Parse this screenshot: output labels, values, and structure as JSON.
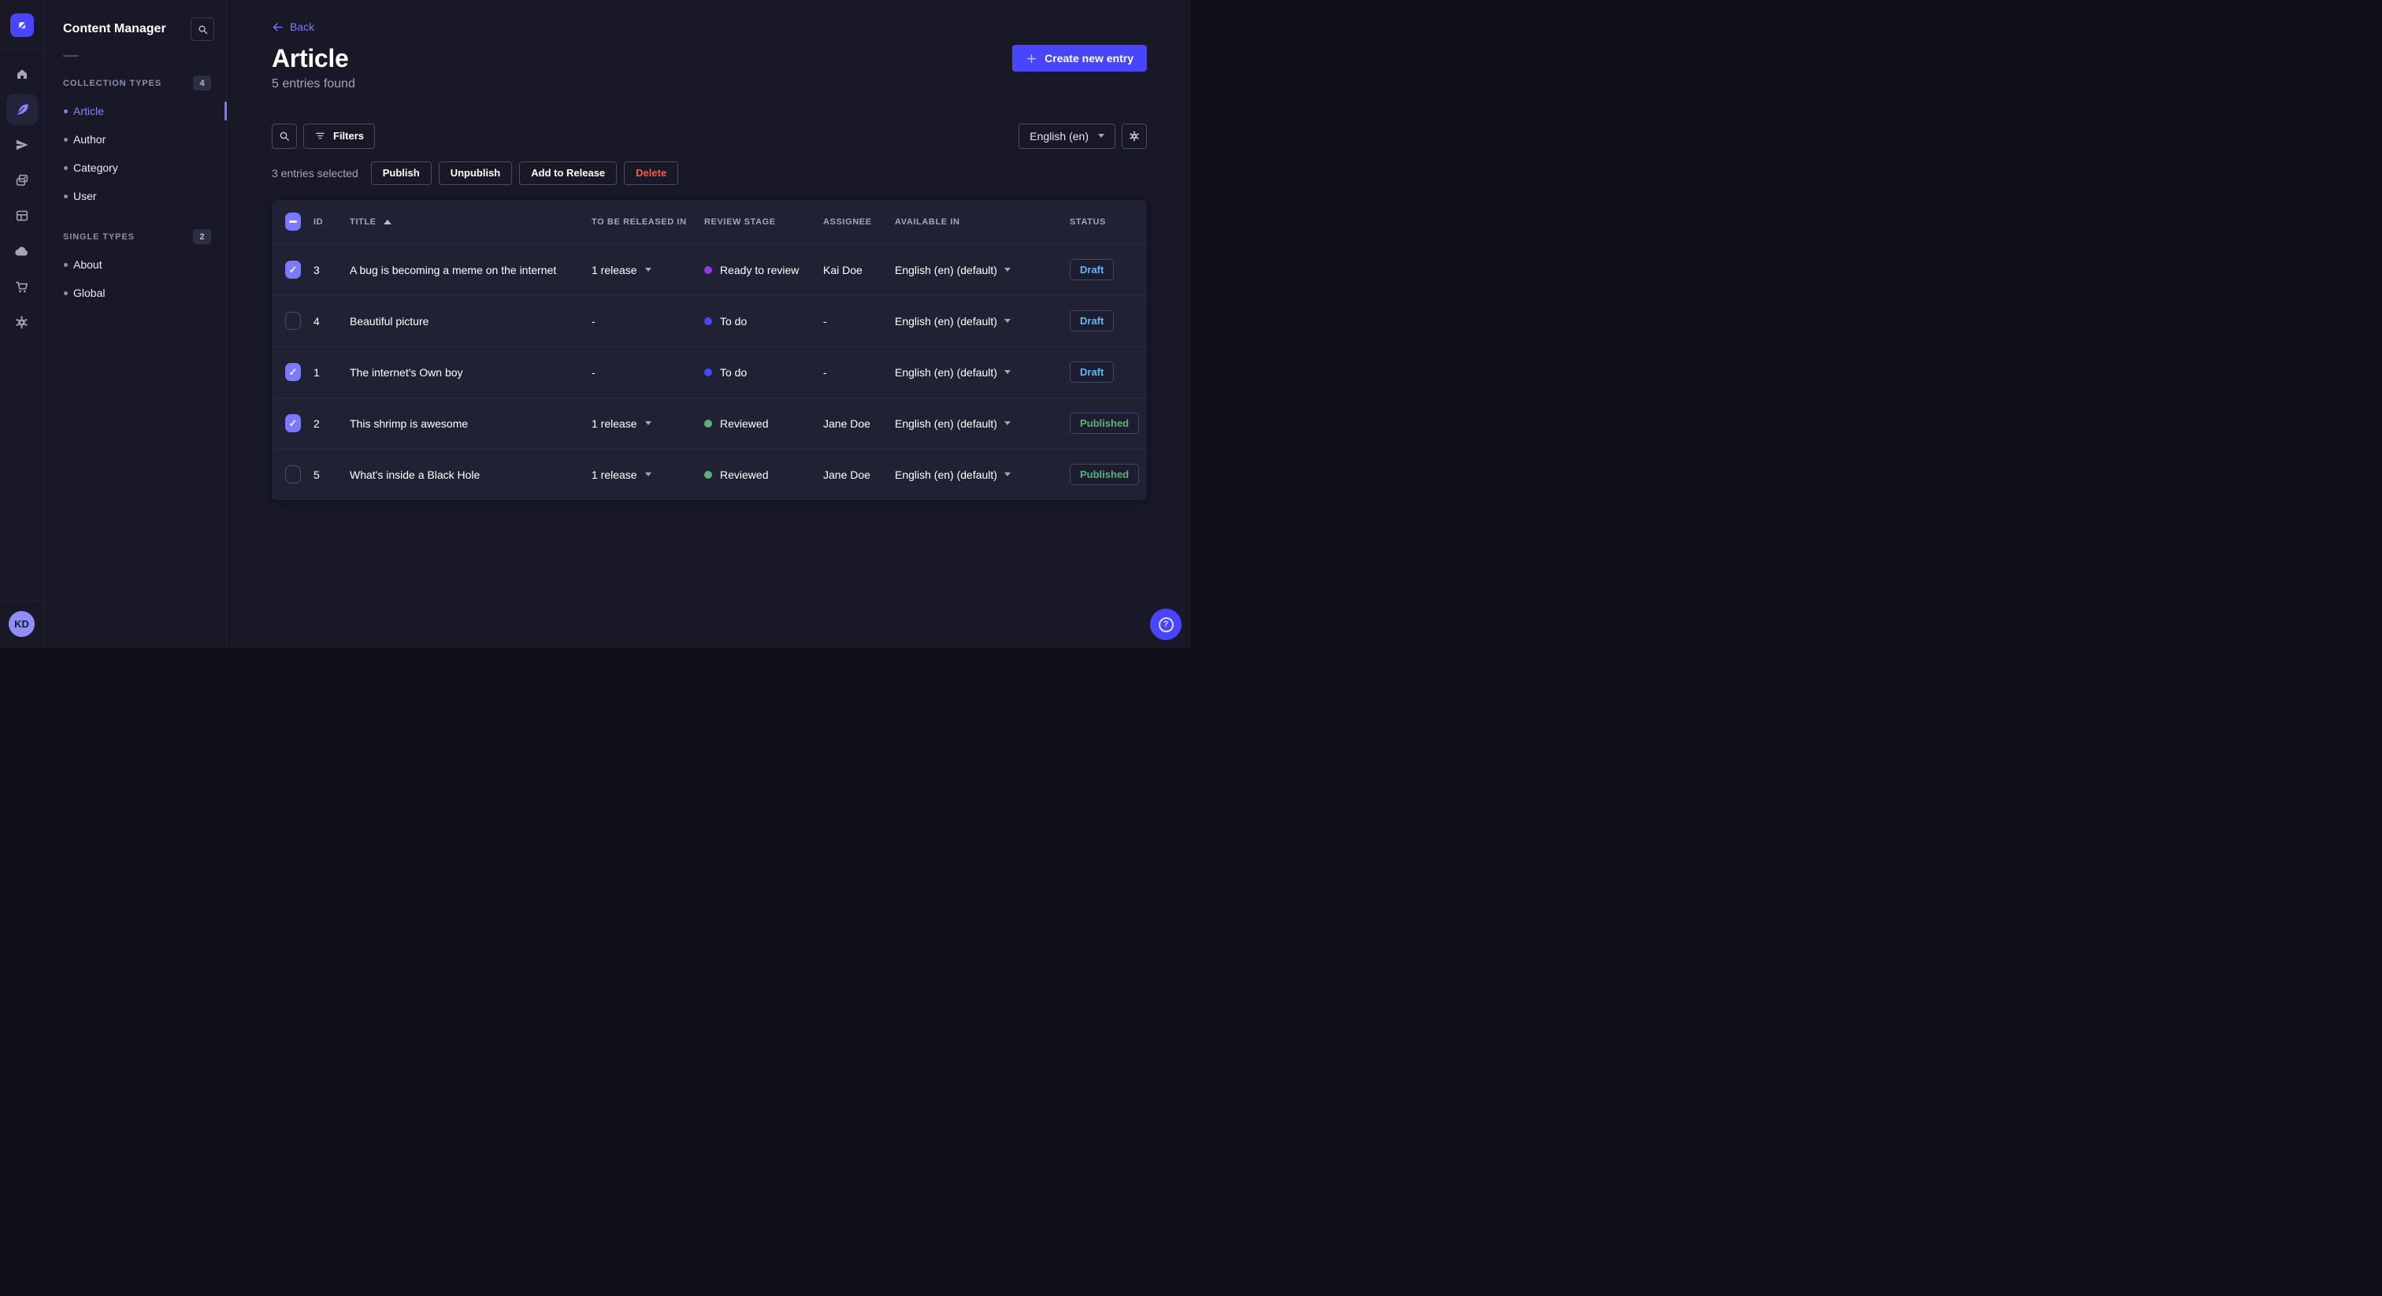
{
  "colors": {
    "primary": "#4945ff",
    "primary_light": "#7b79ff",
    "danger": "#ee5e52",
    "success": "#5cb176",
    "draft_blue": "#66b7f1",
    "page_bg": "#181826",
    "card_bg": "#212134"
  },
  "rail": {
    "logo_icon": "strapi-logo",
    "items": [
      "home",
      "content-manager",
      "releases",
      "media-library",
      "content-type-builder",
      "deploy",
      "marketplace",
      "settings"
    ],
    "active_item": "content-manager",
    "avatar_initials": "KD"
  },
  "subnav": {
    "title": "Content Manager",
    "search_icon": "search",
    "sections": [
      {
        "label": "COLLECTION TYPES",
        "badge": "4",
        "items": [
          {
            "label": "Article",
            "active": true
          },
          {
            "label": "Author",
            "active": false
          },
          {
            "label": "Category",
            "active": false
          },
          {
            "label": "User",
            "active": false
          }
        ]
      },
      {
        "label": "SINGLE TYPES",
        "badge": "2",
        "items": [
          {
            "label": "About",
            "active": false
          },
          {
            "label": "Global",
            "active": false
          }
        ]
      }
    ]
  },
  "header": {
    "back_label": "Back",
    "title": "Article",
    "subtitle": "5 entries found",
    "create_button_label": "Create new entry"
  },
  "toolbar": {
    "filters_label": "Filters",
    "locale_value": "English (en)"
  },
  "selection": {
    "summary": "3 entries selected",
    "publish_label": "Publish",
    "unpublish_label": "Unpublish",
    "add_to_release_label": "Add to Release",
    "delete_label": "Delete"
  },
  "table": {
    "header_checkbox": "indeterminate",
    "sort": {
      "column": "TITLE",
      "direction": "asc"
    },
    "columns": {
      "id": "ID",
      "title": "TITLE",
      "release": "TO BE RELEASED IN",
      "stage": "REVIEW STAGE",
      "assignee": "ASSIGNEE",
      "available": "AVAILABLE IN",
      "status": "STATUS"
    },
    "rows": [
      {
        "checkbox": "checked",
        "id": "3",
        "title": "A bug is becoming a meme on the internet",
        "release": "1 release",
        "release_caret": true,
        "stage": "Ready to review",
        "stage_color": "#9736e8",
        "assignee": "Kai Doe",
        "locale": "English (en) (default)",
        "status": "Draft",
        "status_color": "#66b7f1"
      },
      {
        "checkbox": "unchecked",
        "id": "4",
        "title": "Beautiful picture",
        "release": "-",
        "release_caret": false,
        "stage": "To do",
        "stage_color": "#4945ff",
        "assignee": "-",
        "locale": "English (en) (default)",
        "status": "Draft",
        "status_color": "#66b7f1"
      },
      {
        "checkbox": "checked",
        "id": "1",
        "title": "The internet's Own boy",
        "release": "-",
        "release_caret": false,
        "stage": "To do",
        "stage_color": "#4945ff",
        "assignee": "-",
        "locale": "English (en) (default)",
        "status": "Draft",
        "status_color": "#66b7f1"
      },
      {
        "checkbox": "checked",
        "id": "2",
        "title": "This shrimp is awesome",
        "release": "1 release",
        "release_caret": true,
        "stage": "Reviewed",
        "stage_color": "#5cb176",
        "assignee": "Jane Doe",
        "locale": "English (en) (default)",
        "status": "Published",
        "status_color": "#5cb176"
      },
      {
        "checkbox": "unchecked",
        "id": "5",
        "title": "What's inside a Black Hole",
        "release": "1 release",
        "release_caret": true,
        "stage": "Reviewed",
        "stage_color": "#5cb176",
        "assignee": "Jane Doe",
        "locale": "English (en) (default)",
        "status": "Published",
        "status_color": "#5cb176"
      }
    ]
  },
  "help_button": {
    "icon": "question-mark",
    "glyph": "?"
  }
}
